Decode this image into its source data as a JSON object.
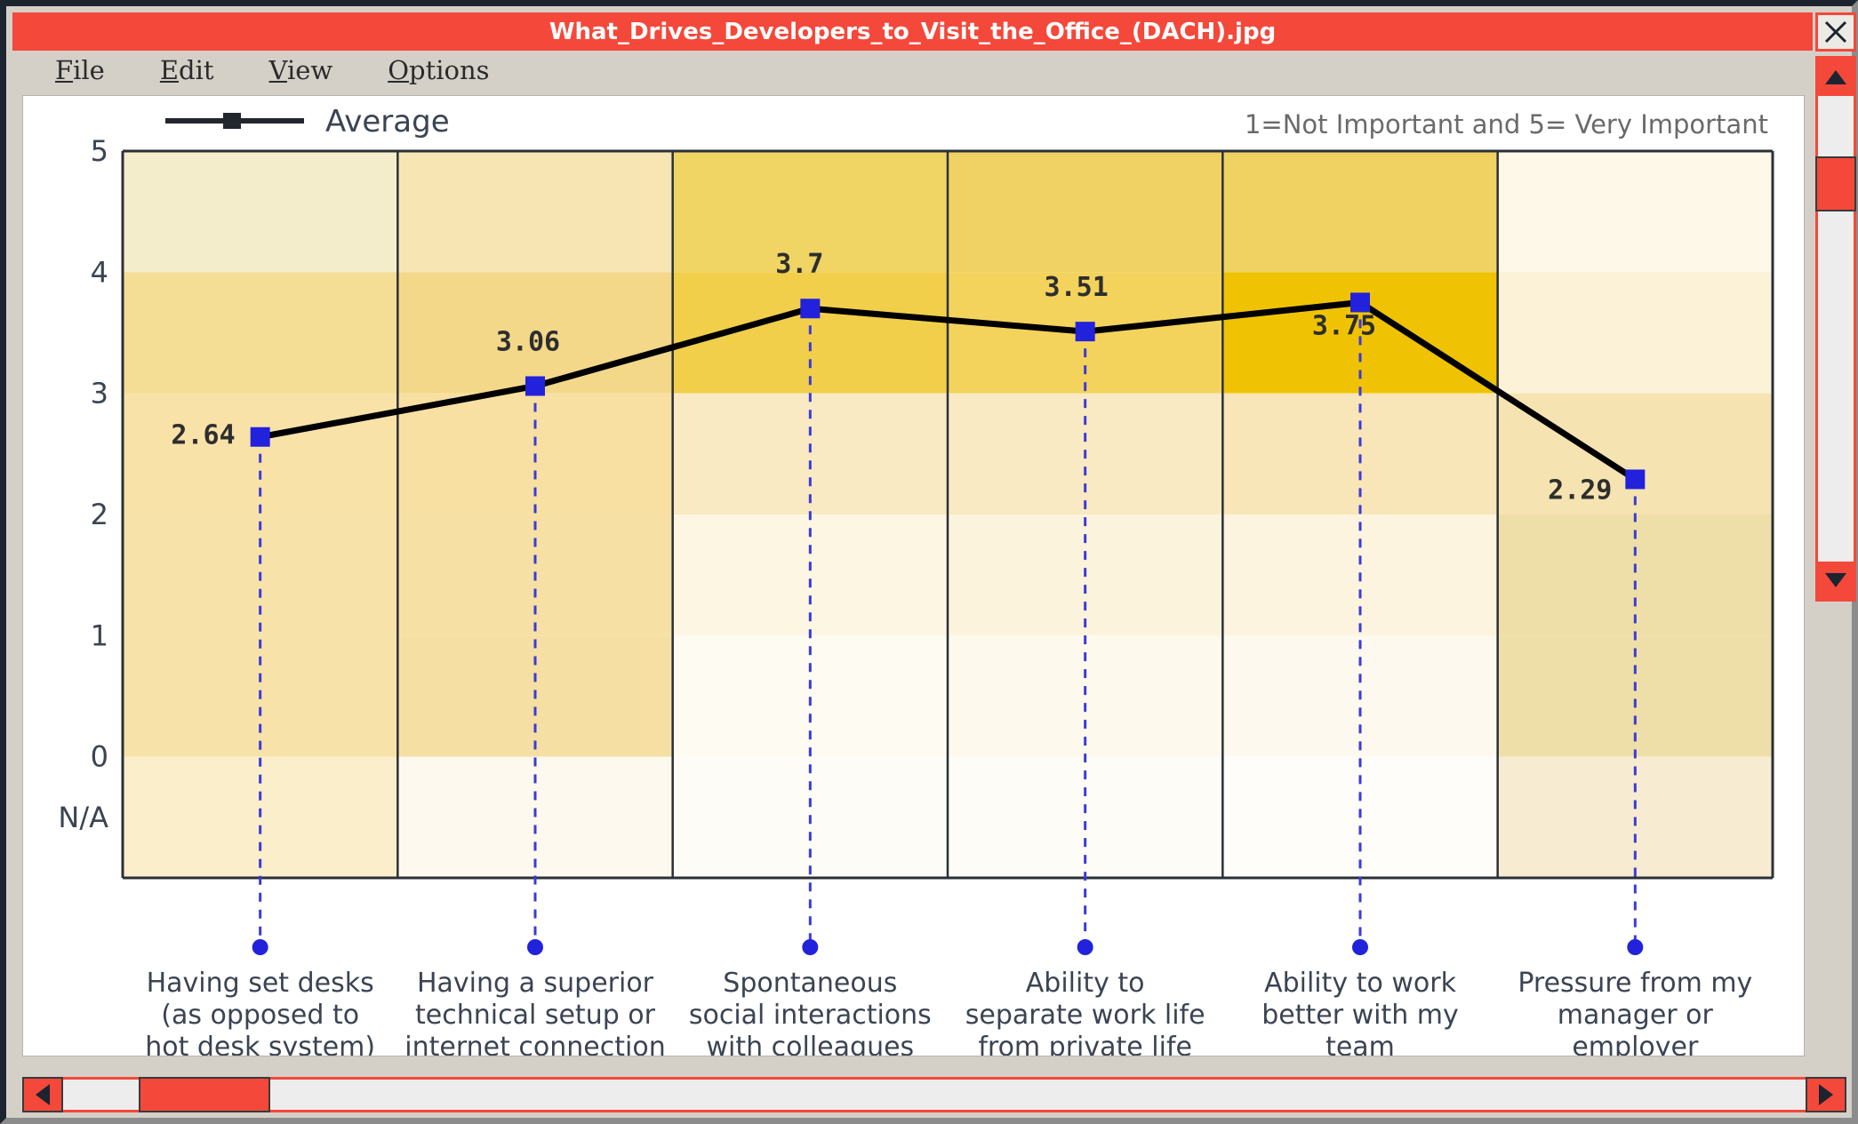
{
  "window": {
    "title": "What_Drives_Developers_to_Visit_the_Office_(DACH).jpg",
    "close_label": "✕"
  },
  "menubar": {
    "items": [
      {
        "mnemonic": "F",
        "rest": "ile",
        "name": "file"
      },
      {
        "mnemonic": "E",
        "rest": "dit",
        "name": "edit"
      },
      {
        "mnemonic": "V",
        "rest": "iew",
        "name": "view"
      },
      {
        "mnemonic": "O",
        "rest": "ptions",
        "name": "options"
      }
    ]
  },
  "chart_data": {
    "type": "line",
    "title": "",
    "subtitle": "",
    "xlabel": "",
    "ylabel": "",
    "note": "1=Not Important and 5= Very Important",
    "legend": {
      "entries": [
        "Average"
      ],
      "position": "top-left"
    },
    "grid": false,
    "ylim": [
      -1,
      5
    ],
    "ytick_labels": [
      "5",
      "4",
      "3",
      "2",
      "1",
      "0",
      "N/A"
    ],
    "ytick_values": [
      5,
      4,
      3,
      2,
      1,
      0,
      -0.75
    ],
    "categories": [
      "Having set desks (as opposed to hot desk system)",
      "Having a superior technical setup or internet connection",
      "Spontaneous social interactions with colleagues",
      "Ability to separate work life from private life",
      "Ability to work better with my team",
      "Pressure from my manager or employer"
    ],
    "category_lines": [
      [
        "Having set desks",
        "(as opposed to",
        "hot desk system)"
      ],
      [
        "Having a superior",
        "technical setup or",
        "internet connection"
      ],
      [
        "Spontaneous",
        "social interactions",
        "with colleagues"
      ],
      [
        "Ability to",
        "separate work life",
        "from private life"
      ],
      [
        "Ability to work",
        "better with my",
        "team"
      ],
      [
        "Pressure from my",
        "manager or",
        "employer"
      ]
    ],
    "series": [
      {
        "name": "Average",
        "values": [
          2.64,
          3.06,
          3.7,
          3.51,
          3.75,
          2.29
        ],
        "value_labels": [
          "2.64",
          "3.06",
          "3.7",
          "3.51",
          "3.75",
          "2.29"
        ],
        "line_color": "#000000",
        "marker_color": "#2222dd"
      }
    ],
    "heatmap": {
      "row_bands": [
        "4-5",
        "3-4",
        "2-3",
        "1-2",
        "0-1",
        "N/A"
      ],
      "colors": [
        [
          "#f4edcb",
          "#f7e6b4",
          "#f0d464",
          "#efd263",
          "#f0d263",
          "#fdf8e7"
        ],
        [
          "#f4dd94",
          "#f3d88a",
          "#f1cf4b",
          "#f3d35c",
          "#efc303",
          "#fbf2d7"
        ],
        [
          "#f8e2a8",
          "#f7e0a2",
          "#f9eac4",
          "#f9eac4",
          "#f8e6b8",
          "#f6e3b2"
        ],
        [
          "#f7e2a9",
          "#f6e0a4",
          "#fdf6e2",
          "#fcf3dc",
          "#fcf4de",
          "#eedfa8"
        ],
        [
          "#f7e2a9",
          "#f6dfa2",
          "#fefbf2",
          "#fdf9ed",
          "#fdf9ee",
          "#eedfa8"
        ],
        [
          "#faeecb",
          "#fdf9ee",
          "#fefcf7",
          "#fefcf7",
          "#fefdf9",
          "#f7ecd2"
        ]
      ]
    }
  },
  "colors": {
    "titlebar": "#f4483a",
    "chrome": "#d4d0c8",
    "accent_red": "#f4483a",
    "marker_blue": "#2222dd",
    "line_black": "#000000"
  }
}
